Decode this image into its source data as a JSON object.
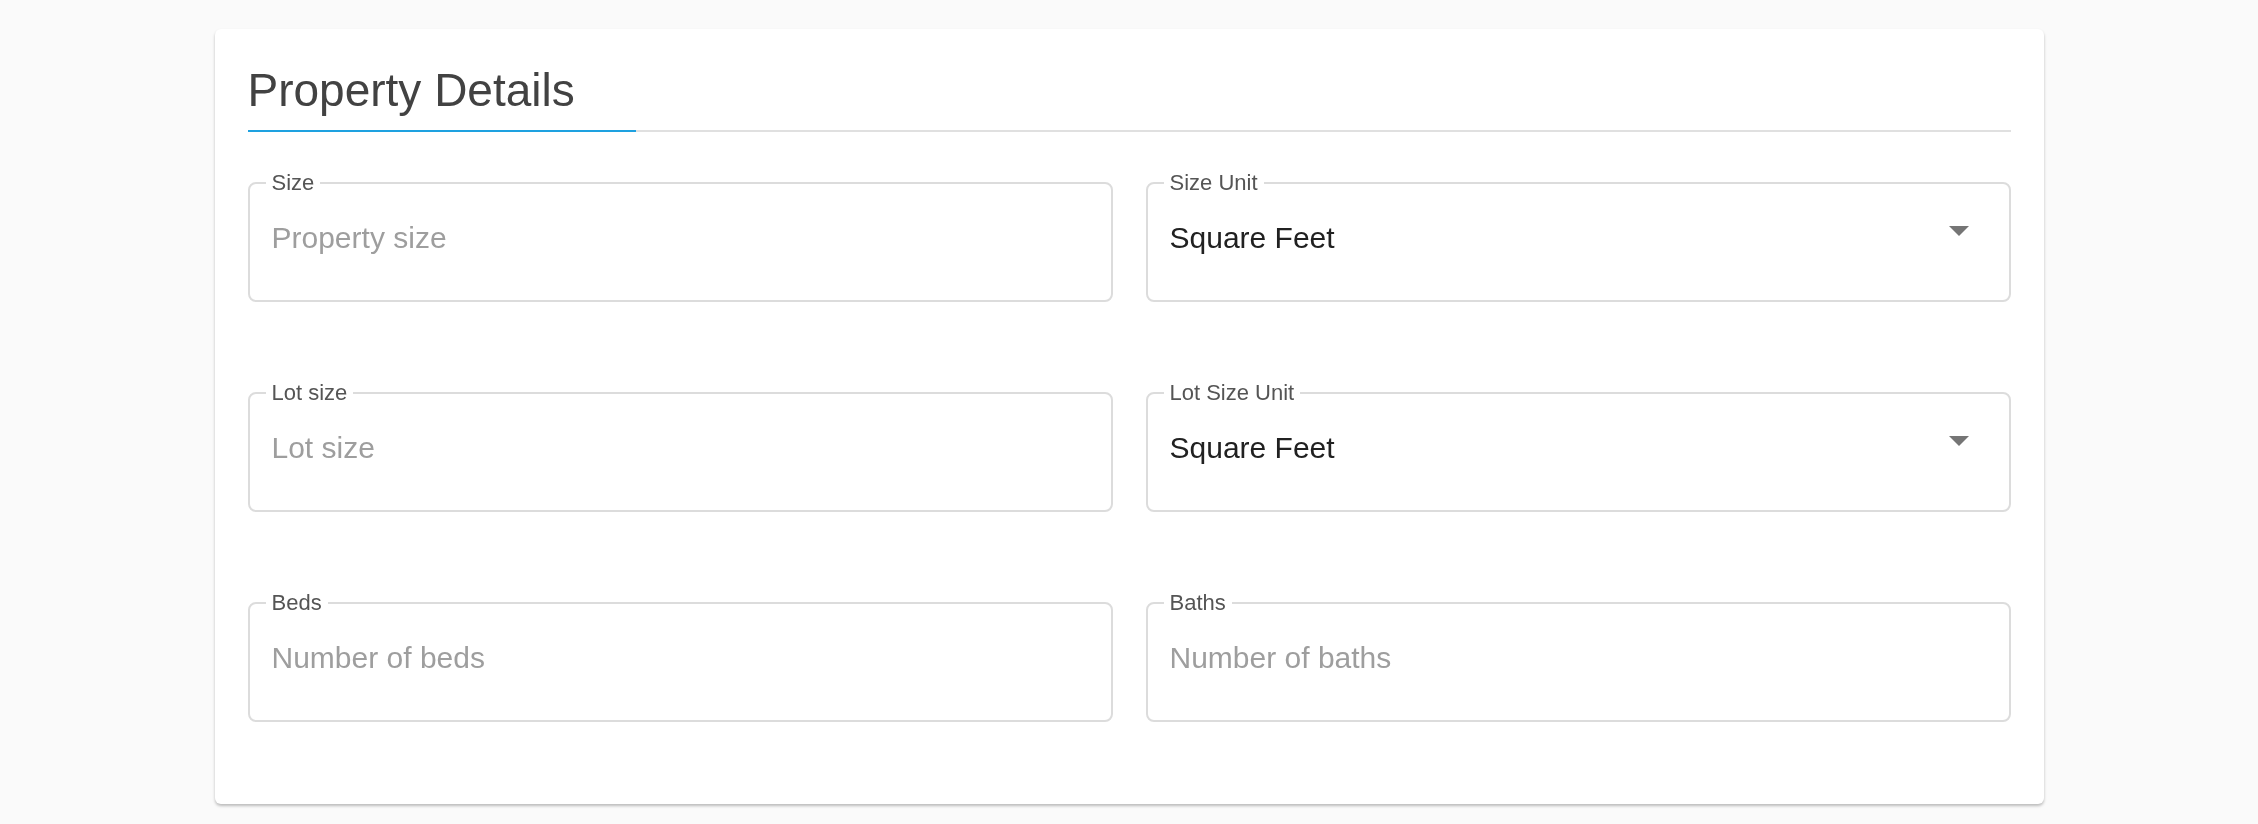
{
  "card": {
    "title": "Property Details"
  },
  "fields": [
    {
      "kind": "text",
      "label": "Size",
      "placeholder": "Property size"
    },
    {
      "kind": "select",
      "label": "Size Unit",
      "value": "Square Feet"
    },
    {
      "kind": "text",
      "label": "Lot size",
      "placeholder": "Lot size"
    },
    {
      "kind": "select",
      "label": "Lot Size Unit",
      "value": "Square Feet"
    },
    {
      "kind": "text",
      "label": "Beds",
      "placeholder": "Number of beds"
    },
    {
      "kind": "text",
      "label": "Baths",
      "placeholder": "Number of baths"
    }
  ]
}
